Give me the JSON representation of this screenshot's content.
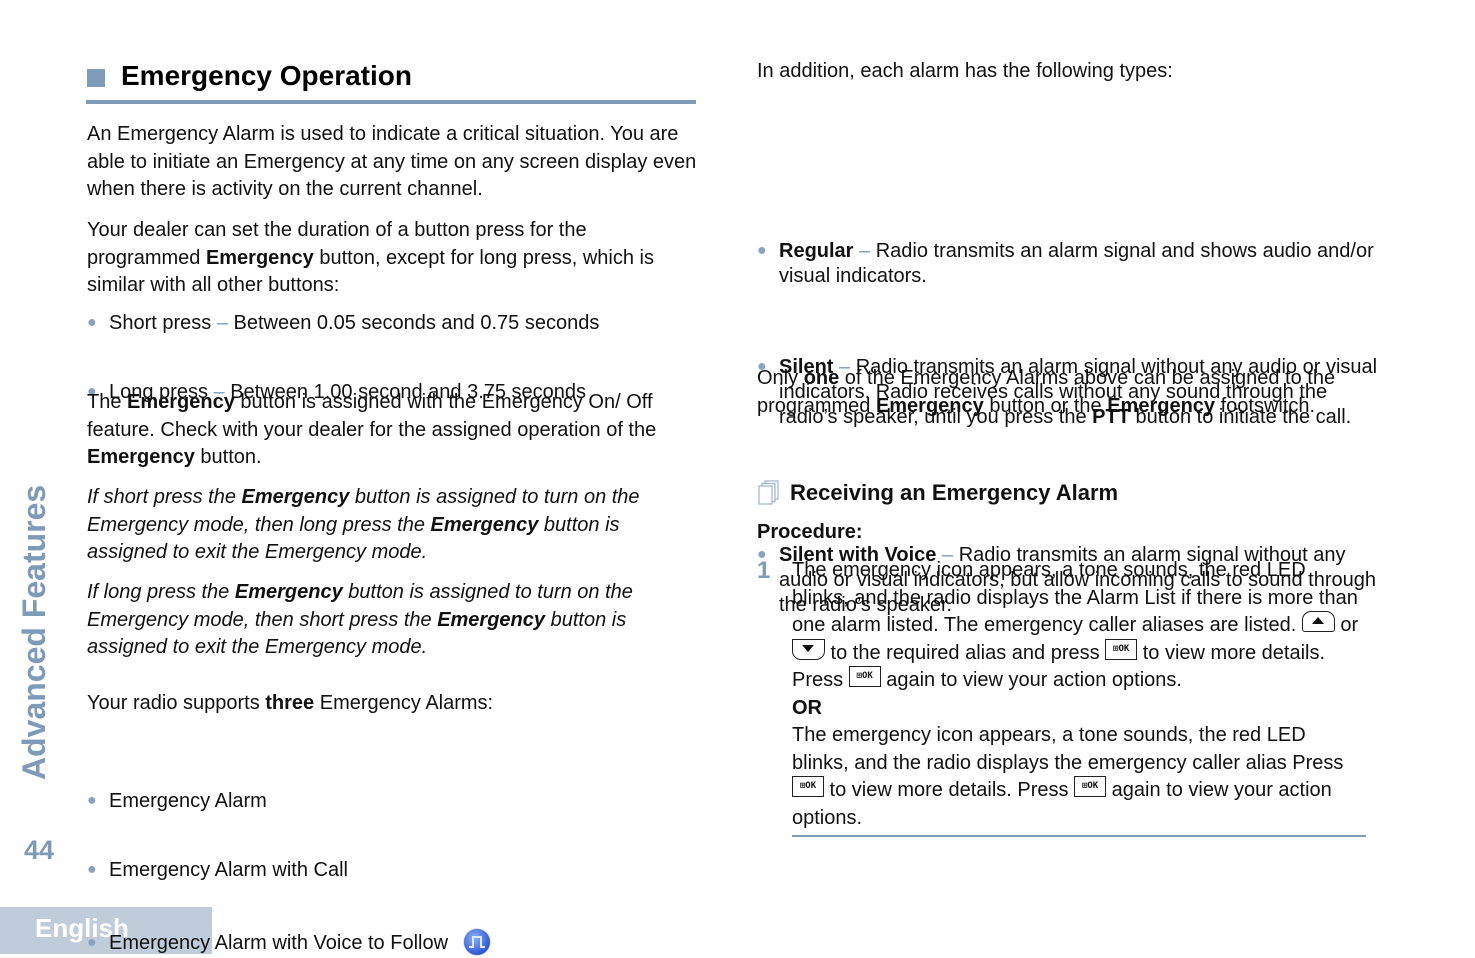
{
  "sidebar": {
    "section_title": "Advanced Features",
    "page_number": "44",
    "language": "English"
  },
  "heading": {
    "title": "Emergency Operation"
  },
  "left": {
    "intro": "An Emergency Alarm is used to indicate a critical situation. You are able to initiate an Emergency at any time on any screen display even when there is activity on the current channel.",
    "dealer_p": {
      "before": "Your dealer can set the duration of a button press for the programmed ",
      "bold": "Emergency",
      "after": " button, except for long press, which is similar with all other buttons:"
    },
    "press_items": [
      {
        "term": "Short press",
        "dash": " – ",
        "desc": "Between 0.05 seconds and 0.75 seconds"
      },
      {
        "term": "Long press",
        "dash": " – ",
        "desc": "Between 1.00 second and 3.75 seconds"
      }
    ],
    "assign_p": {
      "t1": "The ",
      "b1": "Emergency",
      "t2": " button is assigned with the Emergency On/ Off feature. Check with your dealer for the assigned operation of the ",
      "b2": "Emergency",
      "t3": " button."
    },
    "italic_1": {
      "t1": "If short press the ",
      "b1": "Emergency",
      "t2": " button is assigned to turn on the Emergency mode, then long press the ",
      "b2": "Emergency",
      "t3": " button is assigned to exit the Emergency mode."
    },
    "italic_2": {
      "t1": "If long press the ",
      "b1": "Emergency",
      "t2": " button is assigned to turn on the Emergency mode, then short press the ",
      "b2": "Emergency",
      "t3": " button is assigned to exit the Emergency mode."
    },
    "supports_p": {
      "before": "Your radio supports ",
      "bold": "three",
      "after": " Emergency Alarms:"
    },
    "alarm_items": [
      {
        "label": "Emergency Alarm"
      },
      {
        "label": "Emergency Alarm with Call"
      },
      {
        "label": "Emergency Alarm with Voice to Follow",
        "icon": "voice-to-follow-icon"
      }
    ]
  },
  "right": {
    "types_intro": "In addition, each alarm has the following types:",
    "type_items": [
      {
        "term": "Regular",
        "dash": " – ",
        "desc": "Radio transmits an alarm signal and shows audio and/or visual indicators."
      },
      {
        "term": "Silent",
        "dash": " – ",
        "desc1": "Radio transmits an alarm signal without any audio or visual indicators. Radio receives calls without any sound through the radio’s speaker, until you press the ",
        "bold": "PTT",
        "desc2": " button to initiate the call."
      },
      {
        "term": "Silent with Voice",
        "dash": " – ",
        "desc": "Radio transmits an alarm signal without any audio or visual indicators, but allow incoming calls to sound through the radio’s speaker."
      }
    ],
    "only_p": {
      "t1": "Only ",
      "b1": "one",
      "t2": " of the Emergency Alarms above can be assigned to the programmed ",
      "b2": "Emergency",
      "t3": " button or the ",
      "b3": "Emergency",
      "t4": " footswitch."
    },
    "subheading": "Receiving an Emergency Alarm",
    "procedure_label": "Procedure:",
    "step": {
      "number": "1",
      "a1": "The emergency icon appears, a tone sounds, the red LED blinks, and the radio displays the Alarm List if there is more than one alarm listed. The emergency caller aliases are listed. ",
      "a2": " or ",
      "a3": " to the required alias and press ",
      "a4": " to view more details. Press ",
      "a5": " again to view your action options.",
      "or": "OR",
      "b1": "The emergency icon appears, a tone sounds, the red LED blinks, and the radio displays the emergency caller alias Press ",
      "b2": " to view more details. Press ",
      "b3": " again to view your action options.",
      "ok_key_label": "OK"
    }
  },
  "colors": {
    "accent": "#7f9bb8",
    "tab_bg": "#c0ccd9",
    "text": "#111111"
  }
}
